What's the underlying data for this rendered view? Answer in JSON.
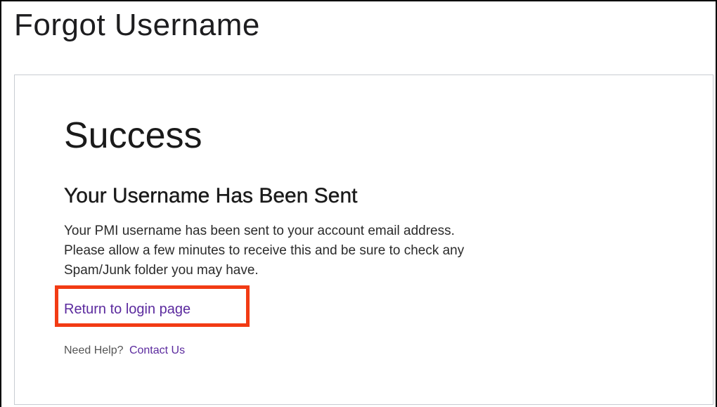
{
  "page": {
    "title": "Forgot Username"
  },
  "card": {
    "heading": "Success",
    "subheading": "Your Username Has Been Sent",
    "message_lines": [
      "Your PMI username has been sent to your account email address.",
      "Please allow a few minutes to receive this and be sure to check any",
      "Spam/Junk folder you may have."
    ],
    "return_link_label": "Return to login page",
    "help_text": "Need Help?",
    "contact_link_label": "Contact Us"
  },
  "colors": {
    "link": "#5b2a9e",
    "highlight_border": "#f23b14",
    "card_border": "#c8ccd2"
  }
}
